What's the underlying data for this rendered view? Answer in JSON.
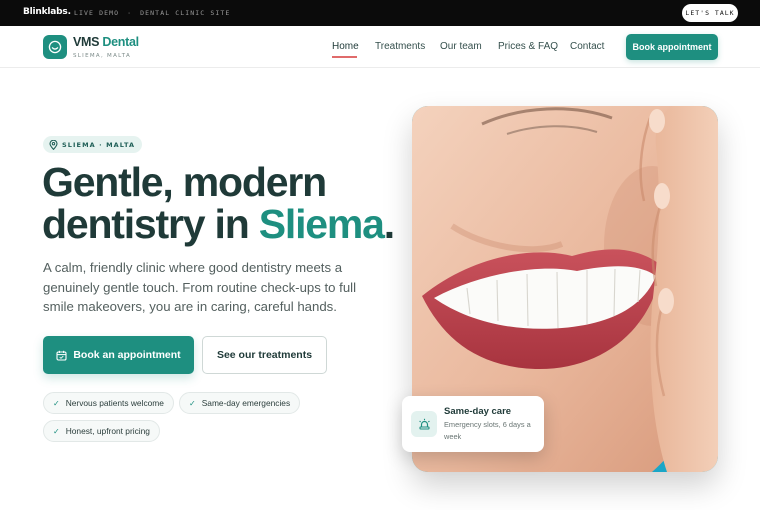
{
  "topbar": {
    "brand": "Blinklabs.",
    "meta": [
      "LIVE DEMO",
      "·",
      "DENTAL CLINIC SITE"
    ],
    "cta": "LET'S TALK"
  },
  "nav": {
    "logo_name": "VMS",
    "logo_accent": "Dental",
    "logo_sub": "SLIEMA, MALTA",
    "links": [
      "Home",
      "Treatments",
      "Our team",
      "Prices & FAQ",
      "Contact"
    ],
    "active": "Home",
    "cta": "Book appointment"
  },
  "hero": {
    "location_pill": "SLIEMA · MALTA",
    "headline_line1": "Gentle, modern",
    "headline_line2_prefix": "dentistry in ",
    "headline_accent": "Sliema",
    "headline_period": ".",
    "lede": "A calm, friendly clinic where good dentistry meets a genuinely gentle touch. From routine check-ups to full smile makeovers, you are in caring, careful hands.",
    "primary_cta": "Book an appointment",
    "secondary_cta": "See our treatments",
    "chips": [
      "Nervous patients welcome",
      "Same-day emergencies",
      "Honest, upfront pricing"
    ]
  },
  "care_card": {
    "title": "Same-day care",
    "text": "Emergency slots, 6 days a week"
  },
  "colors": {
    "brand_teal": "#1e8f80",
    "ink": "#1f3a38",
    "underline": "#e06b6b",
    "photo_backdrop": "#1aa6c7"
  },
  "icons": [
    "logo-smile-icon",
    "location-pin-icon",
    "calendar-icon",
    "check-icon",
    "siren-icon"
  ]
}
